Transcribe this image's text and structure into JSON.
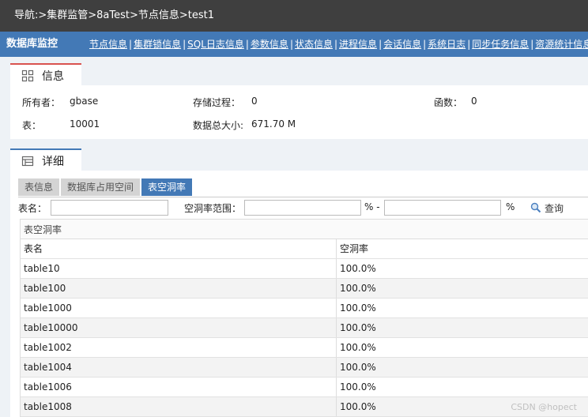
{
  "breadcrumb": "导航:>集群监管>8aTest>节点信息>test1",
  "brand": "数据库监控",
  "nav": [
    "节点信息",
    "集群锁信息",
    "SQL日志信息",
    "参数信息",
    "状态信息",
    "进程信息",
    "会话信息",
    "系统日志",
    "同步任务信息",
    "资源统计信息"
  ],
  "info": {
    "title": "信息",
    "owner_label": "所有者：",
    "owner_value": "gbase",
    "proc_label": "存储过程：",
    "proc_value": "0",
    "func_label": "函数：",
    "func_value": "0",
    "table_label": "表：",
    "table_value": "10001",
    "size_label": "数据总大小:",
    "size_value": "671.70 M"
  },
  "detail": {
    "title": "详细",
    "tabs": [
      "表信息",
      "数据库占用空间",
      "表空洞率"
    ],
    "active_tab": 2,
    "filter": {
      "name_label": "表名：",
      "name_value": "",
      "range_label": "空洞率范围：",
      "from_value": "",
      "pct1": "% -",
      "to_value": "",
      "pct2": "%",
      "query_label": "查询"
    },
    "grid": {
      "caption": "表空洞率",
      "columns": [
        "表名",
        "空洞率"
      ],
      "rows": [
        [
          "table10",
          "100.0%"
        ],
        [
          "table100",
          "100.0%"
        ],
        [
          "table1000",
          "100.0%"
        ],
        [
          "table10000",
          "100.0%"
        ],
        [
          "table1002",
          "100.0%"
        ],
        [
          "table1004",
          "100.0%"
        ],
        [
          "table1006",
          "100.0%"
        ],
        [
          "table1008",
          "100.0%"
        ]
      ]
    }
  },
  "watermark": "CSDN @hopect",
  "colors": {
    "topbar": "#3f3f3f",
    "navbar": "#4379b6",
    "accent_red": "#d9534f",
    "active_tab": "#4379b6"
  }
}
